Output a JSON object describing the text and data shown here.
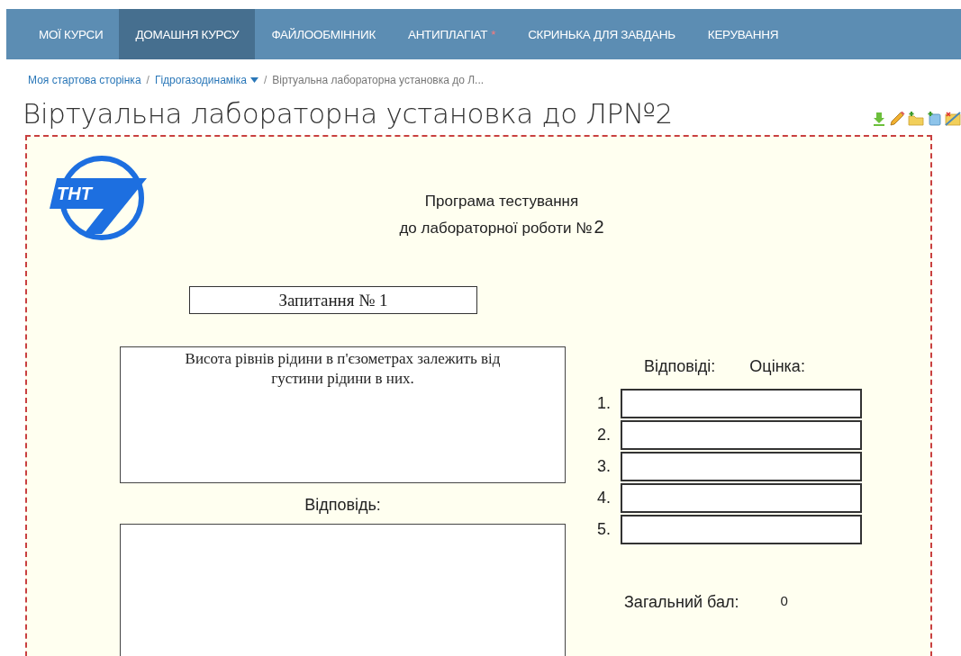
{
  "nav": {
    "items": [
      {
        "label": "МОЇ КУРСИ",
        "selected": false
      },
      {
        "label": "ДОМАШНЯ КУРСУ",
        "selected": true
      },
      {
        "label": "ФАЙЛООБМІННИК",
        "selected": false
      },
      {
        "label": "АНТИПЛАГІАТ",
        "selected": false,
        "badge": "*"
      },
      {
        "label": "СКРИНЬКА ДЛЯ ЗАВДАНЬ",
        "selected": false
      },
      {
        "label": "КЕРУВАННЯ",
        "selected": false
      }
    ]
  },
  "breadcrumb": {
    "items": [
      {
        "label": "Моя стартова сторінка",
        "kind": "link"
      },
      {
        "label": "Гідрогазодинаміка",
        "kind": "menu"
      },
      {
        "label": "Віртуальна лабораторна установка до Л...",
        "kind": "current"
      }
    ],
    "separators": [
      "/",
      "/"
    ]
  },
  "page": {
    "title": "Віртуальна лабораторна установка до ЛР№2"
  },
  "test": {
    "logo_text": "ТНТ",
    "heading_line_1": "Програма тестування",
    "heading_line_2": "до лабораторної роботи №",
    "lab_number": "2",
    "question_label": "Запитання № 1",
    "question_text": "Висота рівнів рідини в п'єзометрах залежить від густини рідини в них.",
    "answer_label": "Відповідь:",
    "answers_heading": "Відповіді:",
    "grade_heading": "Оцінка:",
    "answer_rows": [
      {
        "number": "1."
      },
      {
        "number": "2."
      },
      {
        "number": "3."
      },
      {
        "number": "4."
      },
      {
        "number": "5."
      }
    ],
    "total_label": "Загальний бал:",
    "total_value": "0"
  }
}
